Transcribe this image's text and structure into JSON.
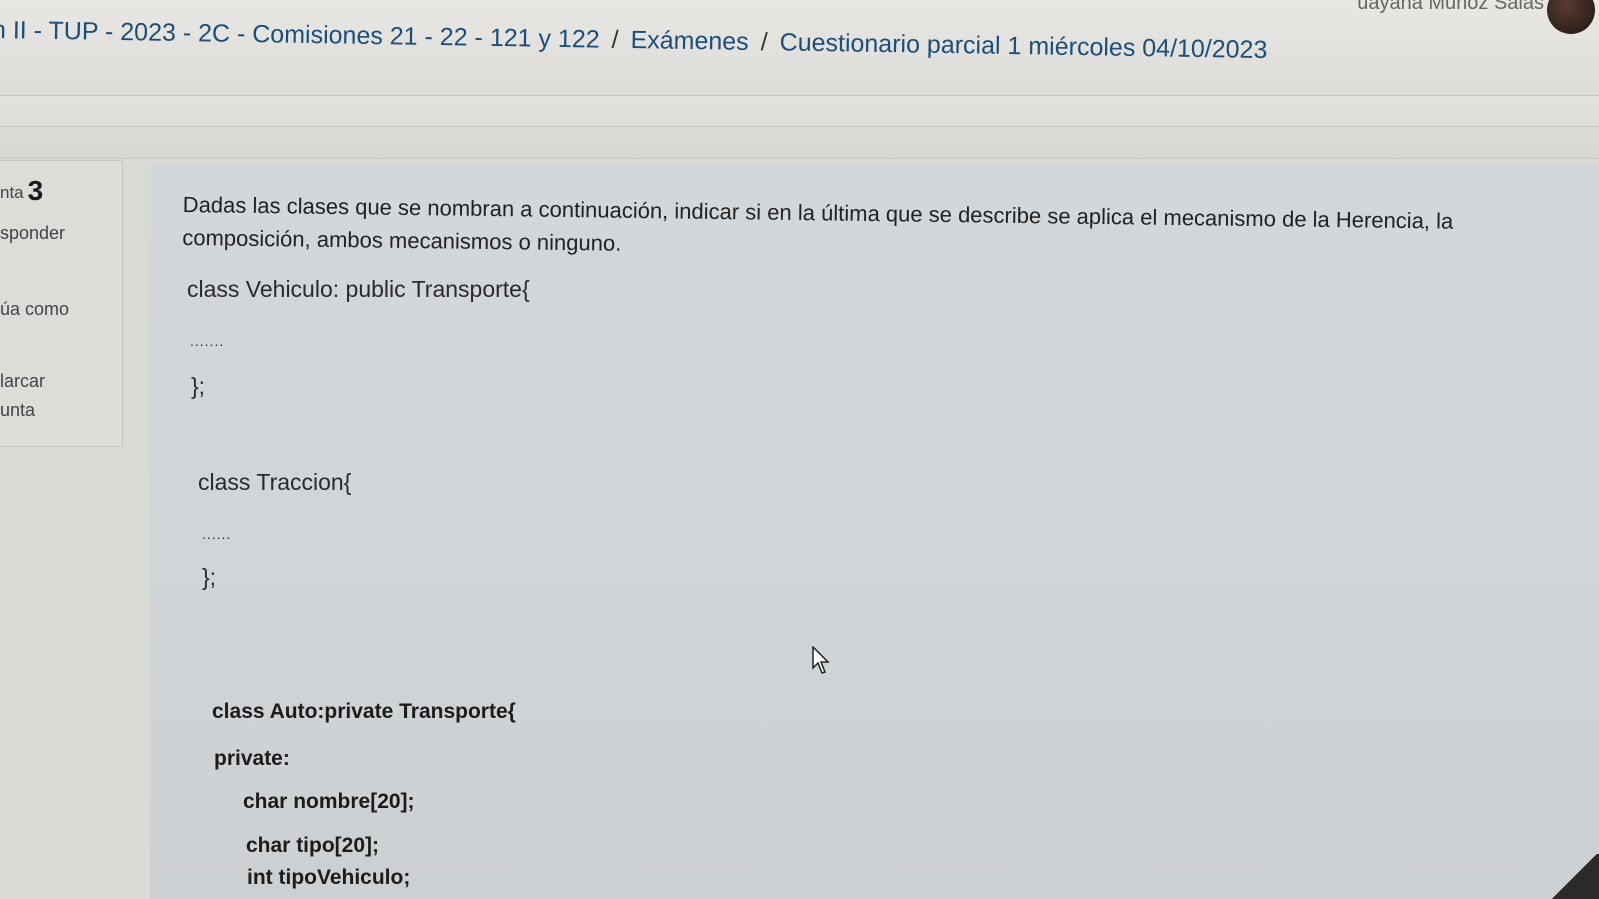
{
  "header": {
    "breadcrumb": [
      "n II - TUP - 2023 - 2C - Comisiones 21 - 22 - 121 y 122",
      "Exámenes",
      "Cuestionario parcial 1 miércoles 04/10/2023"
    ],
    "separator": "/",
    "user_name": "uayana Muñoz Salas"
  },
  "question_info": {
    "label_prefix": "nta",
    "number": "3",
    "status": "sponder",
    "score_line": "úa como",
    "flag_line1": "larcar",
    "flag_line2": "unta"
  },
  "question": {
    "text": "Dadas las clases que se nombran a continuación, indicar si en la última que se describe se aplica el mecanismo de la Herencia, la composición, ambos mecanismos o ninguno.",
    "code_1": [
      "class Vehiculo: public Transporte{",
      ".......",
      "};"
    ],
    "code_2": [
      "class Traccion{",
      "......",
      "};"
    ],
    "code_3": [
      "class Auto:private Transporte{",
      "private:",
      "char nombre[20];",
      "char tipo[20];",
      "int tipoVehiculo;"
    ]
  }
}
